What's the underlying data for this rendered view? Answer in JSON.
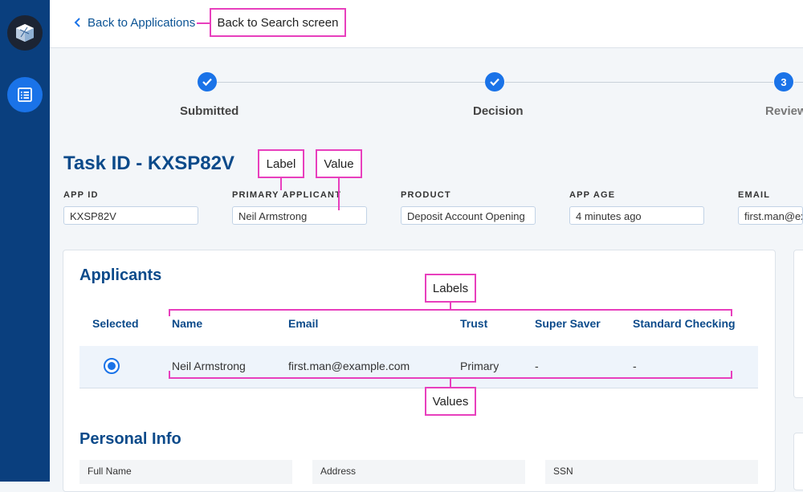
{
  "nav": {
    "back_label": "Back to Applications",
    "logo_icon": "cube-logo-icon",
    "menu_icon": "list-icon"
  },
  "stepper": {
    "steps": [
      {
        "label": "Submitted",
        "state": "complete",
        "marker": ""
      },
      {
        "label": "Decision",
        "state": "complete",
        "marker": ""
      },
      {
        "label": "Review",
        "state": "current",
        "marker": "3"
      }
    ]
  },
  "task": {
    "title": "Task ID - KXSP82V",
    "fields": [
      {
        "label": "APP ID",
        "value": "KXSP82V"
      },
      {
        "label": "PRIMARY APPLICANT",
        "value": "Neil Armstrong"
      },
      {
        "label": "PRODUCT",
        "value": "Deposit Account Opening"
      },
      {
        "label": "APP AGE",
        "value": "4 minutes ago"
      },
      {
        "label": "EMAIL",
        "value": "first.man@example.com"
      }
    ]
  },
  "applicants": {
    "title": "Applicants",
    "columns": [
      "Selected",
      "Name",
      "Email",
      "Trust",
      "Super Saver",
      "Standard Checking"
    ],
    "rows": [
      {
        "selected": true,
        "name": "Neil Armstrong",
        "email": "first.man@example.com",
        "trust": "Primary",
        "super_saver": "-",
        "standard_checking": "-"
      }
    ]
  },
  "personal_info": {
    "title": "Personal Info",
    "fields": [
      "Full Name",
      "Address",
      "SSN"
    ]
  },
  "annotations": {
    "back": "Back to Search screen",
    "label": "Label",
    "value": "Value",
    "labels": "Labels",
    "values": "Values"
  },
  "colors": {
    "sidebar": "#0a3f7e",
    "accent": "#1a73e8",
    "heading": "#0b4a8a",
    "annotation": "#e83fbd"
  }
}
